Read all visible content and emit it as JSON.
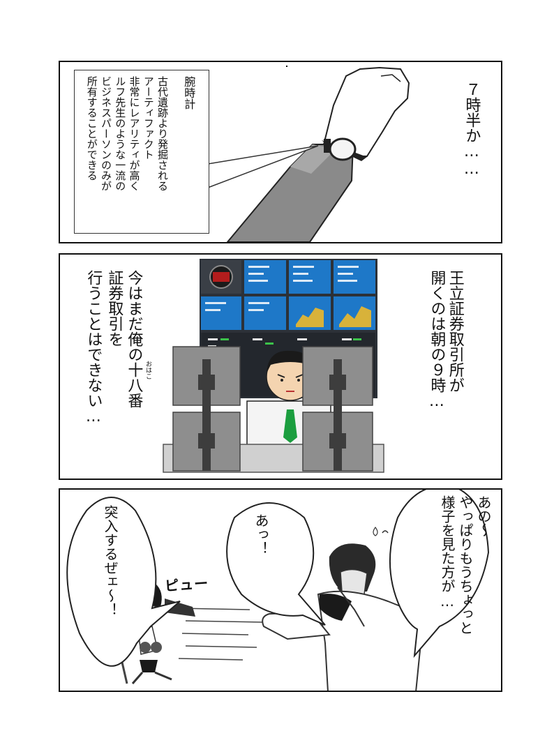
{
  "panel1": {
    "narration": "７時半か……",
    "note_title": "腕時計",
    "note_body": "古代遺跡より発掘される\nアーティファクト\n非常にレアリティが高く\nルフ先生のような一流の\nビジネスパーソンのみが\n所有することができる"
  },
  "panel2": {
    "narration_right": "王立証券取引所が\n開くのは朝の９時…",
    "narration_left_line1": "今はまだ俺の十八番",
    "narration_left_line2": "証券取引を",
    "narration_left_line3": "行うことはできない…",
    "ruby": "おはこ"
  },
  "panel3": {
    "bubble_right": "あの〜\nやっぱりもうちょっと\n様子を見た方が…",
    "bubble_middle": "あっ！",
    "bubble_left": "突入するぜェ〜！",
    "sfx": "ピュー"
  }
}
